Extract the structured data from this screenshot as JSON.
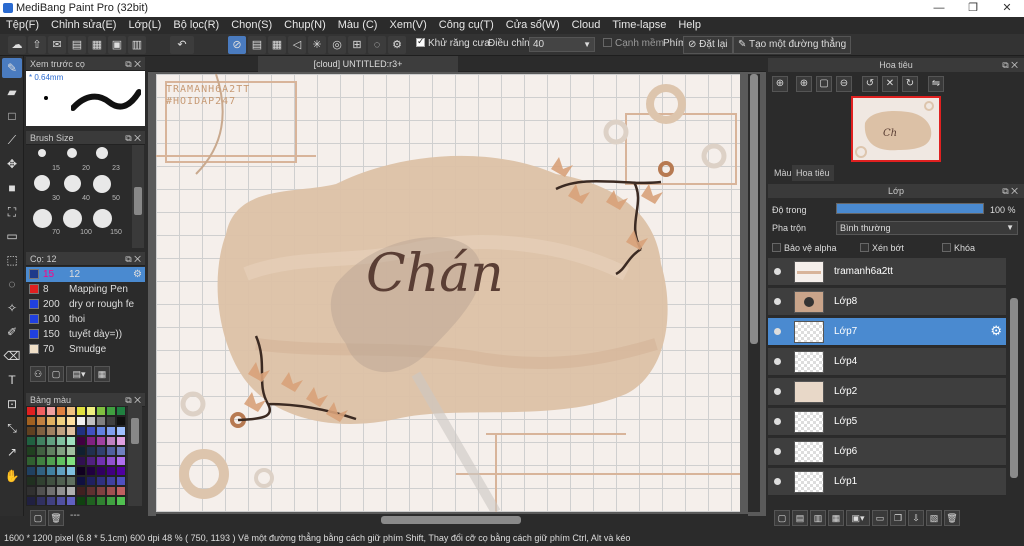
{
  "window": {
    "title": "MediBang Paint Pro (32bit)",
    "min": "—",
    "max": "❐",
    "close": "✕"
  },
  "menu": [
    "Tệp(F)",
    "Chỉnh sửa(E)",
    "Lớp(L)",
    "Bộ lọc(R)",
    "Chọn(S)",
    "Chụp(N)",
    "Màu (C)",
    "Xem(V)",
    "Công cụ(T)",
    "Cửa sổ(W)",
    "Cloud",
    "Time-lapse",
    "Help"
  ],
  "toolbar": {
    "antialias_label": "Khử răng cưa",
    "adjust_label": "Điều chỉnh",
    "adjust_value": "40",
    "edge_label": "Cạnh mềm",
    "key_label": "Phím",
    "reset_label": "Đặt lại",
    "line_label": "Tạo một đường thẳng"
  },
  "panels": {
    "brush_preview_title": "Xem trước cọ",
    "brush_preview_size": "* 0.64mm",
    "brush_size_title": "Brush Size",
    "brush_title": "Cọ: 12",
    "palette_title": "Bảng màu",
    "palette_footer": "---"
  },
  "brush_sizes": [
    "15",
    "20",
    "23",
    "30",
    "40",
    "50",
    "70",
    "100",
    "150"
  ],
  "brushes": [
    {
      "size": "15",
      "name": "12",
      "color": "#1e3a8a",
      "selected": true
    },
    {
      "size": "8",
      "name": "Mapping Pen",
      "color": "#e02020",
      "selected": false
    },
    {
      "size": "200",
      "name": "dry or rough fe",
      "color": "#2040e0",
      "selected": false
    },
    {
      "size": "100",
      "name": "thoi",
      "color": "#2040e0",
      "selected": false
    },
    {
      "size": "150",
      "name": "tuyết dày=))",
      "color": "#2040e0",
      "selected": false
    },
    {
      "size": "70",
      "name": "Smudge",
      "color": "#f0e0c8",
      "selected": false
    }
  ],
  "canvas": {
    "tab_title": "[cloud] UNTITLED:r3+",
    "watermark_1": "TRAMANH6A2TT",
    "watermark_2": "#HOIDAP247",
    "art_word": "Chán"
  },
  "navigator": {
    "title": "Hoa tiêu",
    "tab_color": "Màu",
    "tab_nav": "Hoa tiêu"
  },
  "layers_panel": {
    "title": "Lớp",
    "opacity_label": "Độ trong",
    "opacity_value": "100 %",
    "opacity": 1.0,
    "blend_label": "Pha trộn",
    "blend_value": "Bình thường",
    "protect_alpha": "Bảo vệ alpha",
    "clipping": "Xén bớt",
    "lock": "Khóa"
  },
  "layers": [
    {
      "name": "tramanh6a2tt",
      "active": false
    },
    {
      "name": "Lớp8",
      "active": false
    },
    {
      "name": "Lớp7",
      "active": true
    },
    {
      "name": "Lớp4",
      "active": false
    },
    {
      "name": "Lớp2",
      "active": false
    },
    {
      "name": "Lớp5",
      "active": false
    },
    {
      "name": "Lớp6",
      "active": false
    },
    {
      "name": "Lớp1",
      "active": false
    }
  ],
  "status": "1600 * 1200 pixel   (6.8 * 5.1cm)   600 dpi   48 %   ( 750, 1193 )   Vẽ một đường thẳng bằng cách giữ phím Shift, Thay đổi cỡ cọ bằng cách giữ phím Ctrl, Alt và kéo"
}
